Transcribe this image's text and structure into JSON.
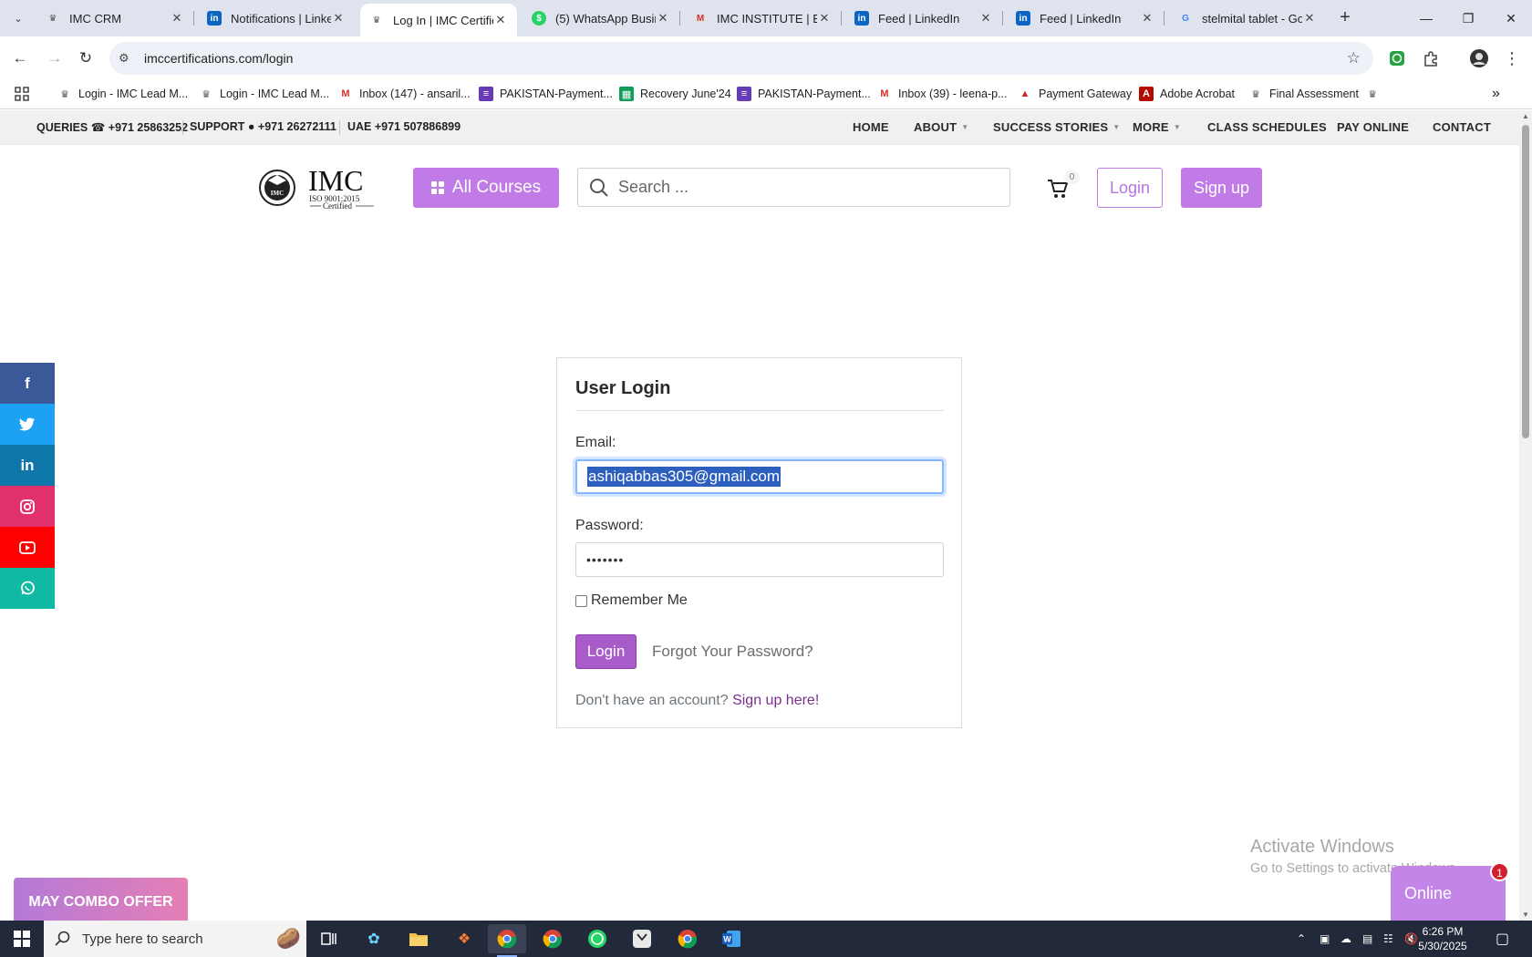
{
  "browser": {
    "tabs": [
      {
        "title": "IMC CRM",
        "icon": "imc-logo-icon",
        "active": false
      },
      {
        "title": "Notifications | Linke",
        "icon": "linkedin-icon",
        "active": false
      },
      {
        "title": "Log In | IMC Certific",
        "icon": "imc-logo-icon",
        "active": true
      },
      {
        "title": "(5) WhatsApp Busin",
        "icon": "whatsapp-business-icon",
        "active": false
      },
      {
        "title": "IMC INSTITUTE | ENI",
        "icon": "gmail-icon",
        "active": false
      },
      {
        "title": "Feed | LinkedIn",
        "icon": "linkedin-icon",
        "active": false
      },
      {
        "title": "Feed | LinkedIn",
        "icon": "linkedin-icon",
        "active": false
      },
      {
        "title": "stelmital tablet - Go",
        "icon": "google-icon",
        "active": false
      }
    ],
    "url": "imccertifications.com/login",
    "bookmarks": [
      {
        "label": "Login - IMC Lead M...",
        "icon": "imc-logo-icon"
      },
      {
        "label": "Login - IMC Lead M...",
        "icon": "imc-logo-icon"
      },
      {
        "label": "Inbox (147) - ansaril...",
        "icon": "gmail-icon"
      },
      {
        "label": "PAKISTAN-Payment...",
        "icon": "forms-icon"
      },
      {
        "label": "Recovery June'24",
        "icon": "sheets-icon"
      },
      {
        "label": "PAKISTAN-Payment...",
        "icon": "forms-icon"
      },
      {
        "label": "Inbox (39) - leena-p...",
        "icon": "gmail-icon"
      },
      {
        "label": "Payment Gateway",
        "icon": "payment-icon"
      },
      {
        "label": "Adobe Acrobat",
        "icon": "acrobat-icon"
      },
      {
        "label": "Final Assessment",
        "icon": "imc-logo-icon"
      }
    ]
  },
  "site": {
    "topbar": {
      "queries": "QUERIES ☎ +971 25863252",
      "support": "SUPPORT ● +971 26272111",
      "uae": "UAE +971 507886899",
      "menu": [
        "HOME",
        "ABOUT",
        "SUCCESS STORIES",
        "MORE",
        "CLASS SCHEDULES",
        "PAY ONLINE",
        "CONTACT"
      ]
    },
    "logo": {
      "name": "IMC",
      "line1": "ISO 9001:2015",
      "line2": "Certified",
      "seal": "IMC"
    },
    "header": {
      "all_courses": "All Courses",
      "search_placeholder": "Search ...",
      "cart_count": "0",
      "login": "Login",
      "signup": "Sign up"
    },
    "login_card": {
      "title": "User Login",
      "email_label": "Email:",
      "email_value": "ashiqabbas305@gmail.com",
      "password_label": "Password:",
      "password_masked": "•••••••",
      "remember_label": "Remember Me",
      "remember_checked": false,
      "login_button": "Login",
      "forgot_link": "Forgot Your Password?",
      "no_account_text": "Don't have an account?",
      "signup_link": "Sign up here!"
    },
    "social": [
      {
        "name": "facebook",
        "glyph": "f",
        "color": "#3b5998"
      },
      {
        "name": "twitter",
        "glyph": "❀",
        "color": "#1da1f2"
      },
      {
        "name": "linkedin",
        "glyph": "in",
        "color": "#0e76a8"
      },
      {
        "name": "instagram",
        "glyph": "◎",
        "color": "#e1306c"
      },
      {
        "name": "youtube",
        "glyph": "▶",
        "color": "#ff0000"
      },
      {
        "name": "whatsapp",
        "glyph": "✆",
        "color": "#10b9a4"
      }
    ],
    "combo_offer": "MAY COMBO OFFER",
    "chat": {
      "label": "Online",
      "badge": "1"
    },
    "watermark": {
      "line1": "Activate Windows",
      "line2": "Go to Settings to activate Windows."
    }
  },
  "taskbar": {
    "search_placeholder": "Type here to search",
    "time": "6:26 PM",
    "date": "5/30/2025"
  },
  "colors": {
    "accent": "#c17be6",
    "login_btn": "#a95cc9",
    "link": "#7a2e8e"
  }
}
